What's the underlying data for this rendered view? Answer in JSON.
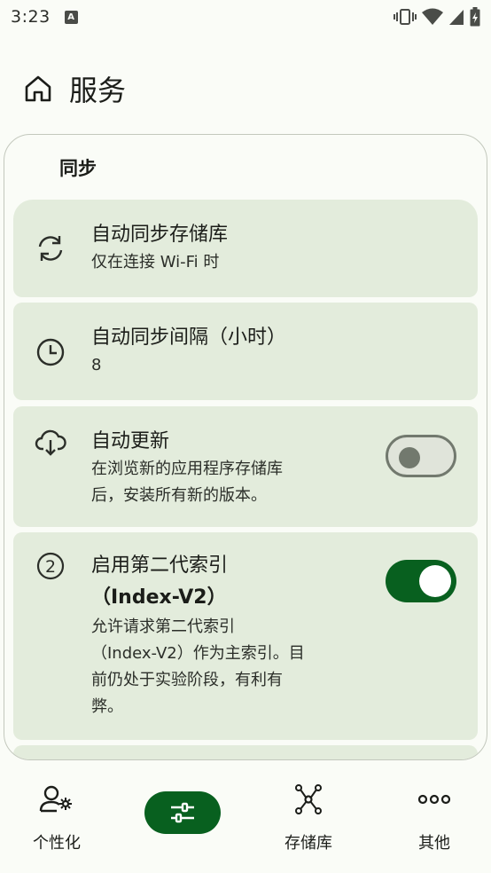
{
  "status_bar": {
    "time": "3:23",
    "notification_icon": "A"
  },
  "header": {
    "title": "服务"
  },
  "section": {
    "title": "同步"
  },
  "items": [
    {
      "icon": "sync-icon",
      "label": "自动同步存储库",
      "desc": "仅在连接 Wi-Fi 时"
    },
    {
      "icon": "clock-icon",
      "label": "自动同步间隔（小时）",
      "desc": "8"
    },
    {
      "icon": "cloud-download-icon",
      "label": "自动更新",
      "desc_lines": [
        "在浏览新的应用程序存储库",
        "后，安装所有新的版本。"
      ],
      "toggle": false
    },
    {
      "icon": "number-two-circle-icon",
      "label_lines": [
        "启用第二代索引",
        "（Index-V2）"
      ],
      "desc_lines": [
        "允许请求第二代索引",
        "（Index-V2）作为主索引。目",
        "前仍处于实验阶段，有利有",
        "弊。"
      ],
      "toggle": true
    }
  ],
  "bottom_nav": [
    {
      "icon": "person-settings-icon",
      "label": "个性化"
    },
    {
      "icon": "sliders-icon",
      "label": "",
      "selected": true
    },
    {
      "icon": "graph-nodes-icon",
      "label": "存储库"
    },
    {
      "icon": "more-dots-icon",
      "label": "其他"
    }
  ],
  "colors": {
    "accent": "#08601f",
    "item_bg": "#e3ecdc",
    "background": "#fafcf7"
  }
}
